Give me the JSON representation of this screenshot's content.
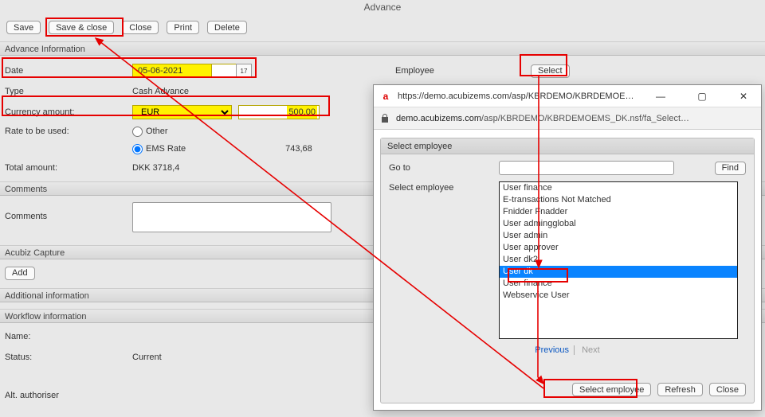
{
  "window": {
    "title": "Advance"
  },
  "toolbar": {
    "save": "Save",
    "save_close": "Save & close",
    "close": "Close",
    "print": "Print",
    "delete": "Delete"
  },
  "sections": {
    "advance_info": "Advance Information",
    "comments": "Comments",
    "capture": "Acubiz Capture",
    "additional": "Additional information",
    "workflow": "Workflow information"
  },
  "form": {
    "date_label": "Date",
    "date_value": "05-06-2021",
    "cal_day": "17",
    "type_label": "Type",
    "type_value": "Cash Advance",
    "employee_label": "Employee",
    "select_btn": "Select",
    "currency_label": "Currency amount:",
    "currency_value": "EUR",
    "amount_value": "500,00",
    "rate_label": "Rate to be used:",
    "rate_other": "Other",
    "rate_ems": "EMS Rate",
    "rate_value": "743,68",
    "total_label": "Total amount:",
    "total_value": "DKK 3718,4",
    "comments_label": "Comments",
    "add_btn": "Add",
    "name_label": "Name:",
    "status_label": "Status:",
    "status_value": "Current",
    "alt_label": "Alt. authoriser"
  },
  "popup": {
    "title": "https://demo.acubizems.com/asp/KBRDEMO/KBRDEMOEMS_…",
    "url_prefix": "demo.acubizems.com",
    "url_rest": "/asp/KBRDEMO/KBRDEMOEMS_DK.nsf/fa_Select…",
    "header": "Select employee",
    "goto_label": "Go to",
    "find_btn": "Find",
    "select_label": "Select employee",
    "items": [
      "User finance",
      "E-transactions Not Matched",
      "Fnidder Fnadder",
      "User admingglobal",
      "User admin",
      "User approver",
      "User dk2",
      "User dk",
      "User finance",
      "Webservice User"
    ],
    "selected_index": 7,
    "prev": "Previous",
    "next": "Next",
    "select_emp_btn": "Select employee",
    "refresh_btn": "Refresh",
    "close_btn": "Close"
  }
}
